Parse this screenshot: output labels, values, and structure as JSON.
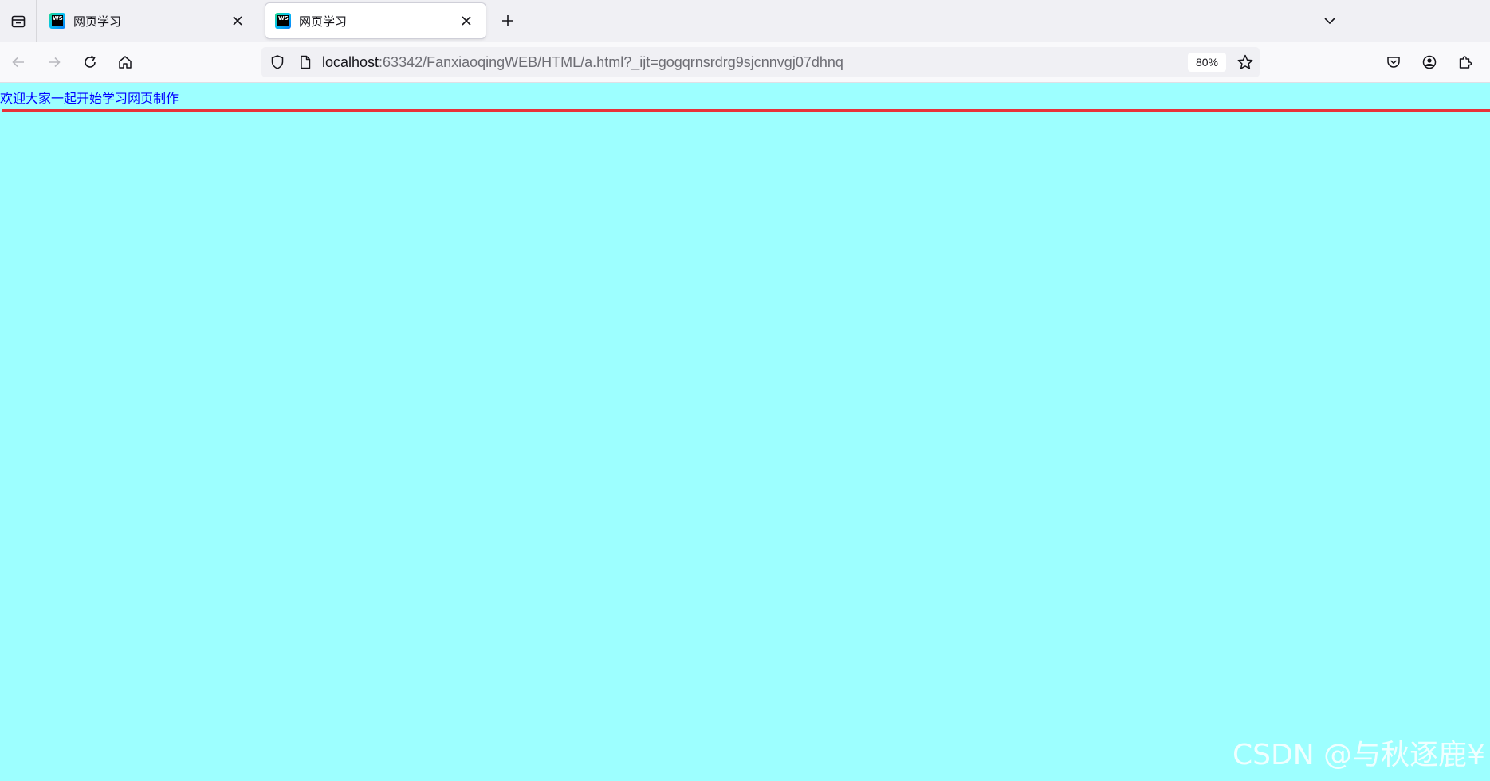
{
  "tabs": [
    {
      "title": "网页学习",
      "active": false
    },
    {
      "title": "网页学习",
      "active": true
    }
  ],
  "url": {
    "host": "localhost",
    "rest": ":63342/FanxiaoqingWEB/HTML/a.html?_ijt=gogqrnsrdrg9sjcnnvgj07dhnq"
  },
  "zoom": "80%",
  "page": {
    "welcome_text": "欢迎大家一起开始学习网页制作",
    "text_color": "#0000ff",
    "background": "#9dffff",
    "hr_color": "#e8323a"
  },
  "watermark": "CSDN @与秋逐鹿¥",
  "icons": {
    "list_all_tabs": "tab-list-icon",
    "tab_close": "close-icon",
    "new_tab": "plus-icon",
    "tab_overflow": "chevron-down-icon",
    "back": "arrow-left-icon",
    "forward": "arrow-right-icon",
    "reload": "reload-icon",
    "home": "home-icon",
    "tracking_protection": "shield-icon",
    "page_info": "page-icon",
    "bookmark": "star-icon",
    "pocket": "pocket-icon",
    "account": "account-icon",
    "extensions": "puzzle-icon"
  }
}
